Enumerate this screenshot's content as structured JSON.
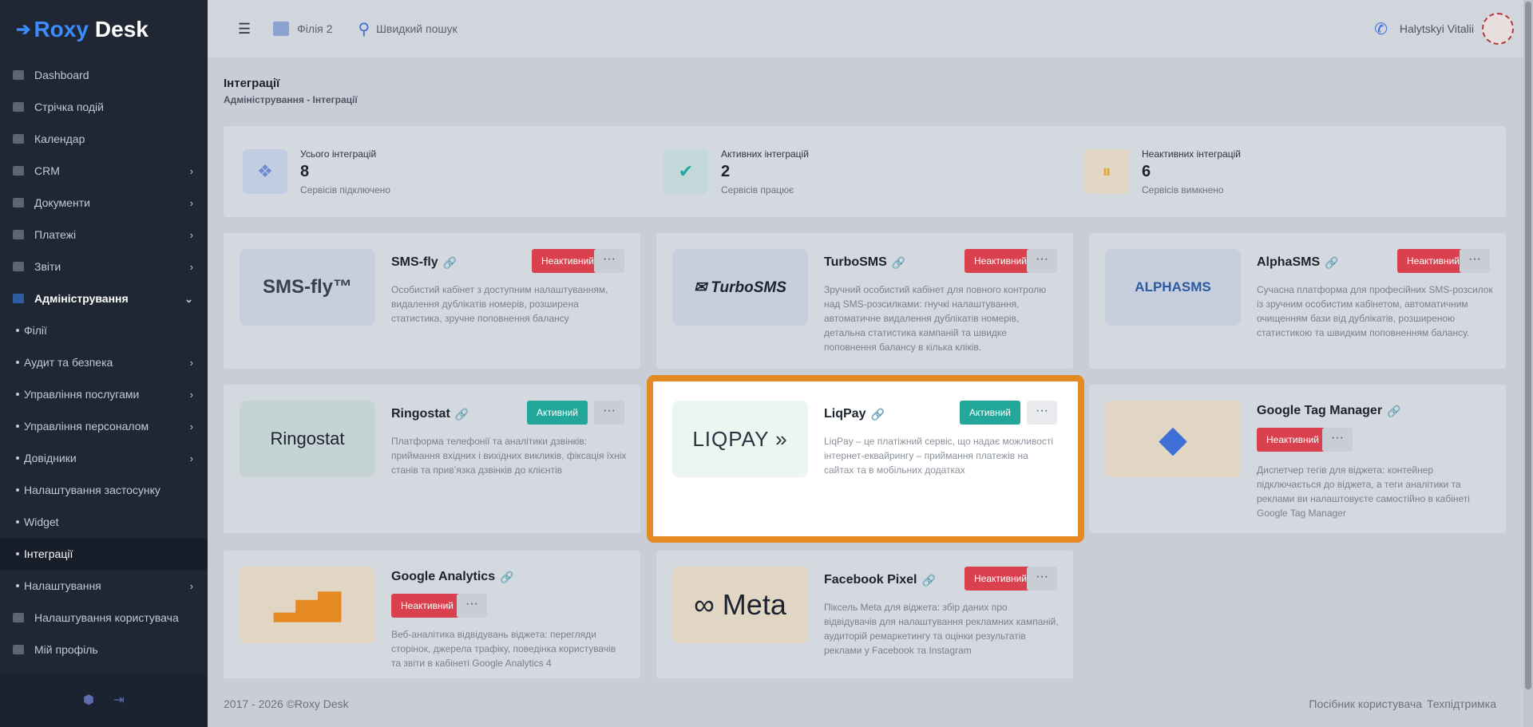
{
  "brand": {
    "roxy": "Roxy",
    "desk": "Desk"
  },
  "sidebar": {
    "items": [
      {
        "label": "Dashboard",
        "chevron": false
      },
      {
        "label": "Стрічка подій",
        "chevron": false
      },
      {
        "label": "Календар",
        "chevron": false
      },
      {
        "label": "CRM",
        "chevron": true
      },
      {
        "label": "Документи",
        "chevron": true
      },
      {
        "label": "Платежі",
        "chevron": true
      },
      {
        "label": "Звіти",
        "chevron": true
      },
      {
        "label": "Адміністрування",
        "chevron": true,
        "expanded": true
      }
    ],
    "sub_items": [
      {
        "label": "Філії",
        "chevron": false
      },
      {
        "label": "Аудит та безпека",
        "chevron": true
      },
      {
        "label": "Управління послугами",
        "chevron": true
      },
      {
        "label": "Управління персоналом",
        "chevron": true
      },
      {
        "label": "Довідники",
        "chevron": true
      },
      {
        "label": "Налаштування застосунку",
        "chevron": false
      },
      {
        "label": "Widget",
        "chevron": false
      },
      {
        "label": "Інтеграції",
        "chevron": false,
        "current": true
      },
      {
        "label": "Налаштування",
        "chevron": true
      }
    ],
    "bottom_items": [
      {
        "label": "Налаштування користувача"
      },
      {
        "label": "Мій профіль"
      }
    ]
  },
  "topbar": {
    "branch": "Філія 2",
    "search_placeholder": "Швидкий пошук",
    "user_name": "Halytskyi Vitalii"
  },
  "page": {
    "title": "Інтеграції",
    "breadcrumb": "Адміністрування - Інтеграції"
  },
  "stats": [
    {
      "label": "Усього інтеграцій",
      "value": "8",
      "sub": "Сервісів підключено",
      "icon": "cubes-icon",
      "color": "#6e8bd0"
    },
    {
      "label": "Активних інтеграцій",
      "value": "2",
      "sub": "Сервісів працює",
      "icon": "check-circle-icon",
      "color": "#22a79a"
    },
    {
      "label": "Неактивних інтеграцій",
      "value": "6",
      "sub": "Сервісів вимкнено",
      "icon": "pause-circle-icon",
      "color": "#e0a838"
    }
  ],
  "cards": [
    {
      "name": "SMS-fly",
      "status": "Неактивний",
      "active": false,
      "logo": "SMS-fly™",
      "desc": "Особистий кабінет з доступним налаштуванням, видалення дублікатів номерів, розширена статистика, зручне поповнення балансу"
    },
    {
      "name": "TurboSMS",
      "status": "Неактивний",
      "active": false,
      "logo": "✉ TurboSMS",
      "desc": "Зручний особистий кабінет для повного контролю над SMS-розсилками: гнучкі налаштування, автоматичне видалення дублікатів номерів, детальна статистика кампаній та швидке поповнення балансу в кілька кліків."
    },
    {
      "name": "AlphaSMS",
      "status": "Неактивний",
      "active": false,
      "logo": "ALPHASMS",
      "desc": "Сучасна платформа для професійних SMS-розсилок із зручним особистим кабінетом, автоматичним очищенням бази від дублікатів, розширеною статистикою та швидким поповненням балансу."
    },
    {
      "name": "Ringostat",
      "status": "Активний",
      "active": true,
      "logo": "Ringostat",
      "desc": "Платформа телефонії та аналітики дзвінків: приймання вхідних і вихідних викликів, фіксація їхніх станів та прив’язка дзвінків до клієнтів"
    },
    {
      "name": "LiqPay",
      "status": "Активний",
      "active": true,
      "logo": "LIQPAY »",
      "desc": "LiqPay – це платіжний сервіс, що надає можливості інтернет-еквайрингу – приймання платежів на сайтах та в мобільних додатках"
    },
    {
      "name": "Google Tag Manager",
      "status": "Неактивний",
      "active": false,
      "logo": "◆",
      "desc": "Диспетчер тегів для віджета: контейнер підключається до віджета, а теги аналітики та реклами ви налаштовуєте самостійно в кабінеті Google Tag Manager"
    },
    {
      "name": "Google Analytics",
      "status": "Неактивний",
      "active": false,
      "logo": "▂▅▇",
      "desc": "Веб-аналітика відвідувань віджета: перегляди сторінок, джерела трафіку, поведінка користувачів та звіти в кабінеті Google Analytics 4"
    },
    {
      "name": "Facebook Pixel",
      "status": "Неактивний",
      "active": false,
      "logo": "∞ Meta",
      "desc": "Піксель Meta для віджета: збір даних про відвідувачів для налаштування рекламних кампаній, аудиторій ремаркетингу та оцінки результатів реклами у Facebook та Instagram"
    }
  ],
  "more_label": "···",
  "footer": {
    "copyright": "2017 - 2026 ©Roxy Desk",
    "guide": "Посібник користувача",
    "support": "Техпідтримка"
  },
  "colors": {
    "accent": "#3d8bfd",
    "active_badge": "#22a79a",
    "inactive_badge": "#d9414f",
    "highlight": "#e58a22"
  }
}
